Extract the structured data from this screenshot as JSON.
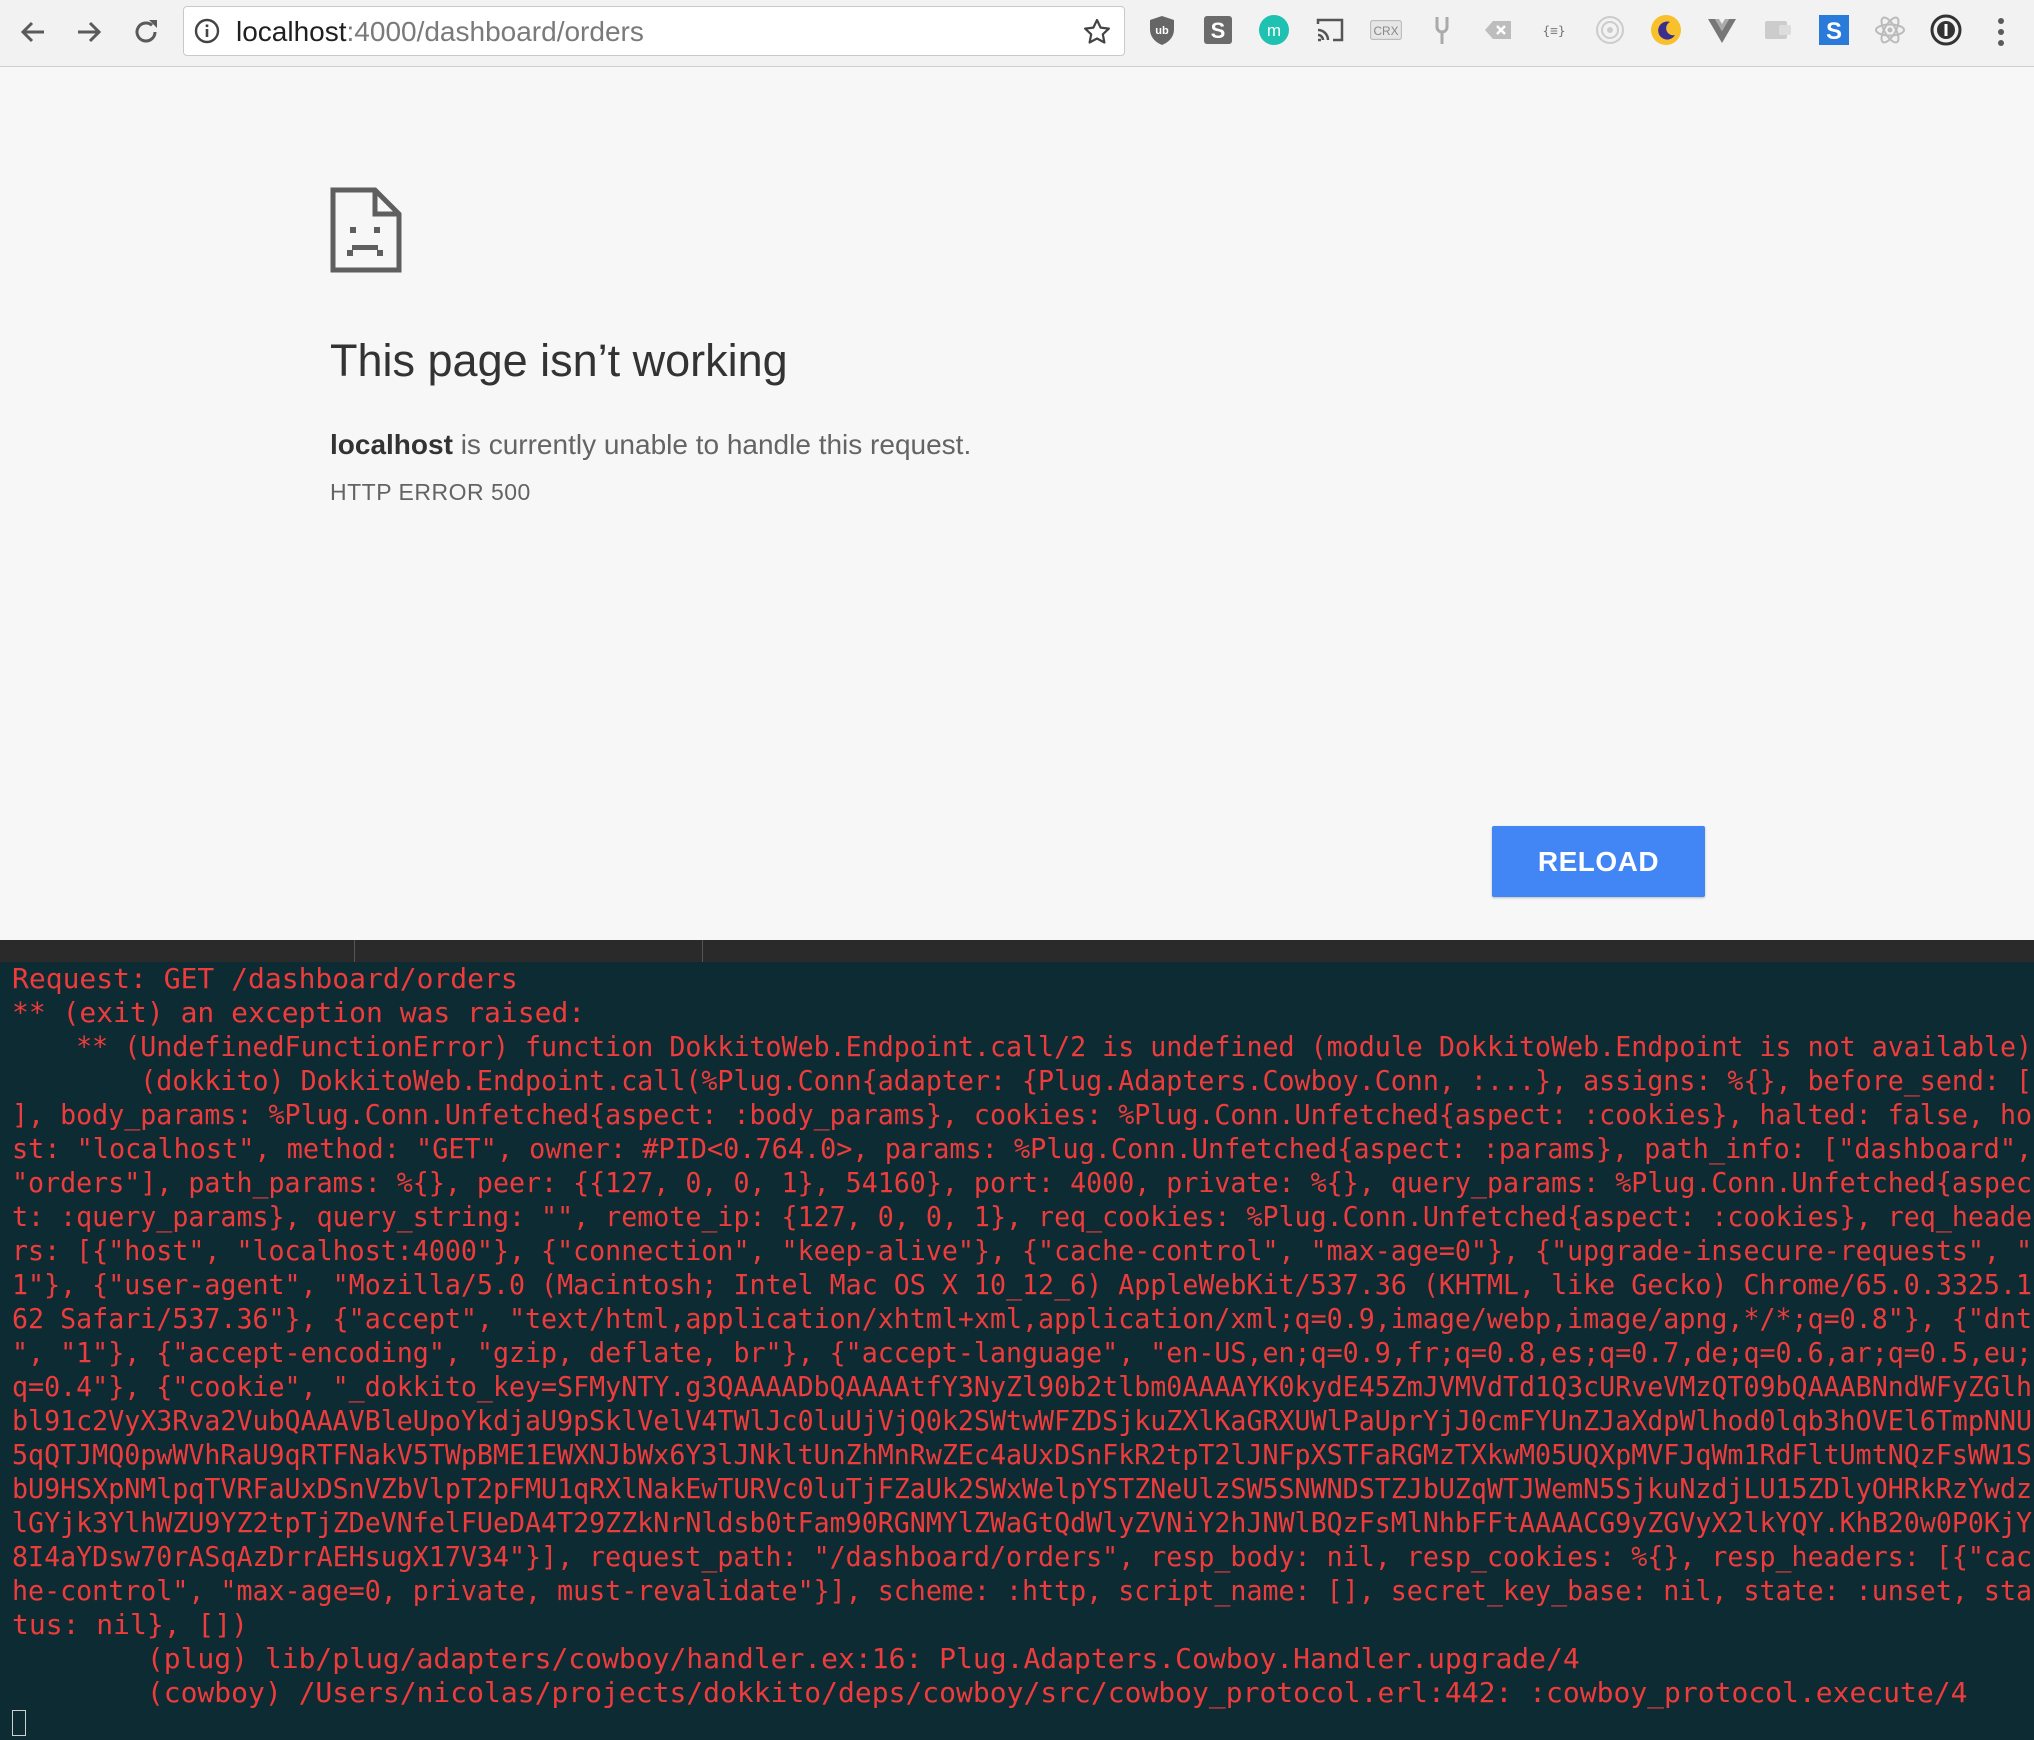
{
  "browser": {
    "url_host": "localhost",
    "url_path": ":4000/dashboard/orders",
    "extensions": [
      {
        "icon": "ublock-icon"
      },
      {
        "icon": "s-extension-icon",
        "text": "S"
      },
      {
        "icon": "m-extension-icon",
        "text": "m"
      },
      {
        "icon": "cast-icon"
      },
      {
        "icon": "crx-icon",
        "text": "CRX"
      },
      {
        "icon": "tuning-fork-icon"
      },
      {
        "icon": "clear-icon"
      },
      {
        "icon": "json-icon",
        "text": "{≡}"
      },
      {
        "icon": "target-icon"
      },
      {
        "icon": "night-mode-icon"
      },
      {
        "icon": "vue-devtools-icon"
      },
      {
        "icon": "screen-capture-icon"
      },
      {
        "icon": "s-blue-icon",
        "text": "S"
      },
      {
        "icon": "react-devtools-icon"
      },
      {
        "icon": "password-manager-icon"
      }
    ]
  },
  "error_page": {
    "title": "This page isn’t working",
    "host": "localhost",
    "message": " is currently unable to handle this request.",
    "code": "HTTP ERROR 500",
    "reload_label": "RELOAD"
  },
  "terminal": {
    "lines": [
      "Request: GET /dashboard/orders",
      "** (exit) an exception was raised:",
      "    ** (UndefinedFunctionError) function DokkitoWeb.Endpoint.call/2 is undefined (module DokkitoWeb.Endpoint is not available)",
      "        (dokkito) DokkitoWeb.Endpoint.call(%Plug.Conn{adapter: {Plug.Adapters.Cowboy.Conn, :...}, assigns: %{}, before_send: [",
      "], body_params: %Plug.Conn.Unfetched{aspect: :body_params}, cookies: %Plug.Conn.Unfetched{aspect: :cookies}, halted: false, ho",
      "st: \"localhost\", method: \"GET\", owner: #PID<0.764.0>, params: %Plug.Conn.Unfetched{aspect: :params}, path_info: [\"dashboard\",",
      "\"orders\"], path_params: %{}, peer: {{127, 0, 0, 1}, 54160}, port: 4000, private: %{}, query_params: %Plug.Conn.Unfetched{aspec",
      "t: :query_params}, query_string: \"\", remote_ip: {127, 0, 0, 1}, req_cookies: %Plug.Conn.Unfetched{aspect: :cookies}, req_heade",
      "rs: [{\"host\", \"localhost:4000\"}, {\"connection\", \"keep-alive\"}, {\"cache-control\", \"max-age=0\"}, {\"upgrade-insecure-requests\", \"",
      "1\"}, {\"user-agent\", \"Mozilla/5.0 (Macintosh; Intel Mac OS X 10_12_6) AppleWebKit/537.36 (KHTML, like Gecko) Chrome/65.0.3325.1",
      "62 Safari/537.36\"}, {\"accept\", \"text/html,application/xhtml+xml,application/xml;q=0.9,image/webp,image/apng,*/*;q=0.8\"}, {\"dnt",
      "\", \"1\"}, {\"accept-encoding\", \"gzip, deflate, br\"}, {\"accept-language\", \"en-US,en;q=0.9,fr;q=0.8,es;q=0.7,de;q=0.6,ar;q=0.5,eu;",
      "q=0.4\"}, {\"cookie\", \"_dokkito_key=SFMyNTY.g3QAAAADbQAAAAtfY3NyZl90b2tlbm0AAAAYK0kydE45ZmJVMVdTd1Q3cURveVMzQT09bQAAABNndWFyZGlh",
      "bl91c2VyX3Rva2VubQAAAVBleUpoYkdjaU9pSklVelV4TWlJc0luUjVjQ0k2SWtwWFZDSjkuZXlKaGRXUWlPaUprYjJ0cmFYUnZJaXdpWlhod0lqb3hOVEl6TmpNNU",
      "5qQTJMQ0pwWVhRaU9qRTFNakV5TWpBME1EWXNJbWx6Y3lJNkltUnZhMnRwZEc4aUxDSnFkR2tpT2lJNFpXSTFaRGMzTXkwM05UQXpMVFJqWm1RdFltUmtNQzFsWW1S",
      "bU9HSXpNMlpqTVRFaUxDSnVZbVlpT2pFMU1qRXlNakEwTURVc0luTjFZaUk2SWxWelpYSTZNeUlzSW5SNWNDSTZJbUZqWTJWemN5SjkuNzdjLU15ZDlyOHRkRzYwdz",
      "lGYjk3YlhWZU9YZ2tpTjZDeVNfelFUeDA4T29ZZkNrNldsb0tFam90RGNMYlZWaGtQdWlyZVNiY2hJNWlBQzFsMlNhbFFtAAAACG9yZGVyX2lkYQY.KhB20w0P0KjY",
      "8I4aYDsw70rASqAzDrrAEHsugX17V34\"}], request_path: \"/dashboard/orders\", resp_body: nil, resp_cookies: %{}, resp_headers: [{\"cac",
      "he-control\", \"max-age=0, private, must-revalidate\"}], scheme: :http, script_name: [], secret_key_base: nil, state: :unset, sta",
      "tus: nil}, [])",
      "        (plug) lib/plug/adapters/cowboy/handler.ex:16: Plug.Adapters.Cowboy.Handler.upgrade/4",
      "        (cowboy) /Users/nicolas/projects/dokkito/deps/cowboy/src/cowboy_protocol.erl:442: :cowboy_protocol.execute/4"
    ]
  }
}
